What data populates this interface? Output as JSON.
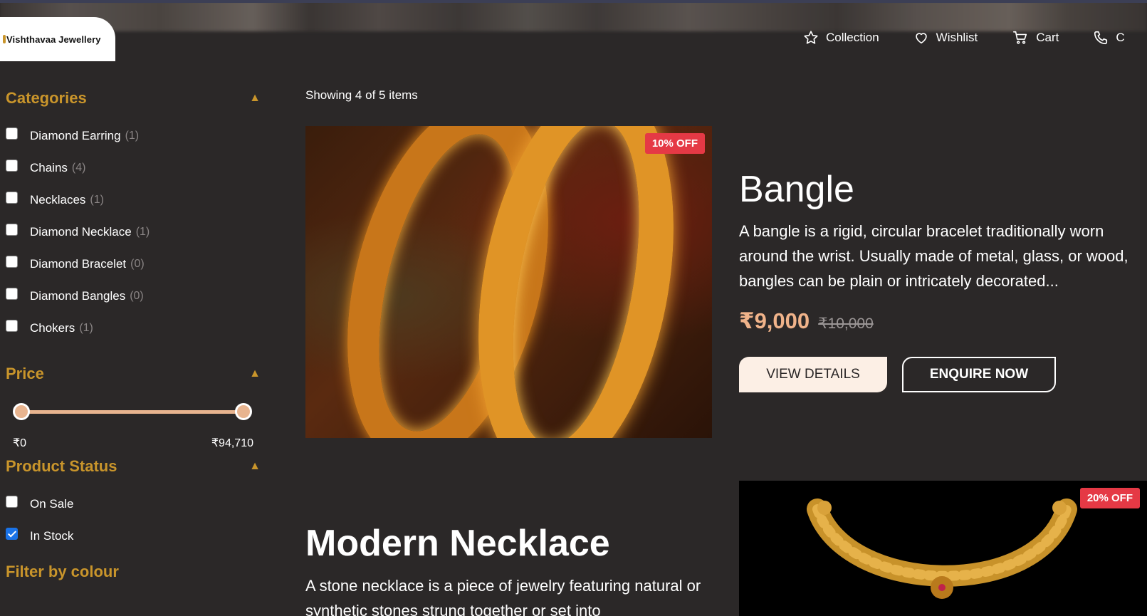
{
  "brand": {
    "name": "Vishthavaa Jewellery"
  },
  "nav": {
    "items": [
      {
        "label": "Collection",
        "icon": "star-icon"
      },
      {
        "label": "Wishlist",
        "icon": "heart-icon"
      },
      {
        "label": "Cart",
        "icon": "cart-icon"
      },
      {
        "label": "C",
        "icon": "phone-icon"
      }
    ]
  },
  "filters": {
    "categories": {
      "title": "Categories",
      "items": [
        {
          "label": "Diamond Earring",
          "count": "(1)",
          "checked": false
        },
        {
          "label": "Chains",
          "count": "(4)",
          "checked": false
        },
        {
          "label": "Necklaces",
          "count": "(1)",
          "checked": false
        },
        {
          "label": "Diamond Necklace",
          "count": "(1)",
          "checked": false
        },
        {
          "label": "Diamond Bracelet",
          "count": "(0)",
          "checked": false
        },
        {
          "label": "Diamond Bangles",
          "count": "(0)",
          "checked": false
        },
        {
          "label": "Chokers",
          "count": "(1)",
          "checked": false
        }
      ]
    },
    "price": {
      "title": "Price",
      "min_label": "₹0",
      "max_label": "₹94,710",
      "range_fraction": [
        0,
        1
      ]
    },
    "status": {
      "title": "Product Status",
      "items": [
        {
          "label": "On Sale",
          "checked": false
        },
        {
          "label": "In Stock",
          "checked": true
        }
      ]
    },
    "colour": {
      "title": "Filter by colour"
    }
  },
  "results": {
    "showing": "Showing 4 of 5 items"
  },
  "products": [
    {
      "title": "Bangle",
      "badge": "10% OFF",
      "description": "A bangle is a rigid, circular bracelet traditionally worn around the wrist. Usually made of metal, glass, or wood, bangles can be plain or intricately decorated...",
      "price": "₹9,000",
      "old_price": "₹10,000",
      "details_label": "VIEW DETAILS",
      "enquire_label": "ENQUIRE NOW"
    },
    {
      "title": "Modern Necklace",
      "badge": "20% OFF",
      "description": "A stone necklace is a piece of jewelry featuring natural or synthetic stones strung together or set into"
    }
  ],
  "colors": {
    "accent": "#c9952b",
    "price": "#f0b38a",
    "badge": "#e53945",
    "background": "#2b2828"
  }
}
